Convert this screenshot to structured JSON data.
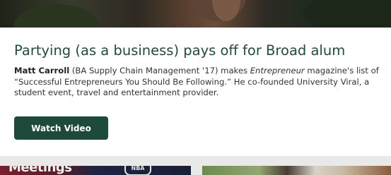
{
  "story": {
    "title": "Partying (as a business) pays off for Broad alum",
    "person": "Matt Carroll",
    "body_part1": " (BA Supply Chain Management '17) makes ",
    "magazine": "Entrepreneur",
    "body_part2": " magazine's list of “Successful Entrepreneurs You Should Be Following.” He co-founded University Viral, a student event, travel and entertainment provider.",
    "button_label": "Watch Video"
  },
  "thumbnails": {
    "left_text": "Meetings",
    "left_badge": "NBA"
  },
  "colors": {
    "title": "#1f4d3a",
    "button_bg": "#1d4a3b",
    "page_bg": "#e9e9e9"
  }
}
